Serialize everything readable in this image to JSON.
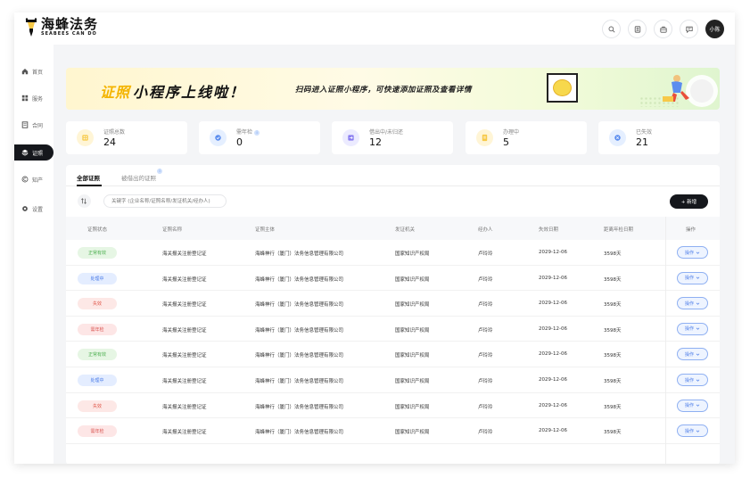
{
  "app": {
    "logo_cn": "海蜂法务",
    "logo_en": "SEABEES CAN DO",
    "avatar": "小陈"
  },
  "sidebar": {
    "items": [
      {
        "label": "首页",
        "icon": "home-icon"
      },
      {
        "label": "服务",
        "icon": "grid-icon"
      },
      {
        "label": "合同",
        "icon": "document-icon"
      },
      {
        "label": "证照",
        "icon": "layers-icon",
        "active": true
      },
      {
        "label": "知产",
        "icon": "copyright-icon"
      },
      {
        "label": "设置",
        "icon": "gear-icon"
      }
    ]
  },
  "banner": {
    "title_highlight": "证照",
    "title_rest": "小程序上线啦！",
    "subtitle": "扫码进入证照小程序，可快速添加证照及查看详情"
  },
  "cards": [
    {
      "label": "证照总数",
      "value": "24",
      "info": false,
      "color": "#f7c948",
      "bg": "#fff5d6"
    },
    {
      "label": "需年检",
      "value": "0",
      "info": true,
      "color": "#5b8def",
      "bg": "#e5efff"
    },
    {
      "label": "借出中/未归还",
      "value": "12",
      "info": false,
      "color": "#8a7df0",
      "bg": "#ecebff"
    },
    {
      "label": "办理中",
      "value": "5",
      "info": false,
      "color": "#f7c948",
      "bg": "#fff5d6"
    },
    {
      "label": "已失效",
      "value": "21",
      "info": false,
      "color": "#5b8def",
      "bg": "#e5efff"
    }
  ],
  "tabs": {
    "all": "全部证照",
    "lent": "被借出的证照",
    "badge": "i"
  },
  "search": {
    "placeholder": "关键字 (企业名称/证照名称/发证机关/经办人)"
  },
  "add_button": "+ 新增",
  "table": {
    "headers": [
      "证照状态",
      "证照名称",
      "证照主体",
      "发证机关",
      "经办人",
      "失效日期",
      "距离年检日期",
      "操作"
    ],
    "rows": [
      {
        "status": "正常有效",
        "status_type": "ok",
        "name": "海关报关注册登记证",
        "subject": "海蜂神行（厦门）法务信息管理有限公司",
        "authority": "国家知识产权局",
        "handler": "卢玲玲",
        "expiry": "2029-12-06",
        "days": "3598天",
        "action": "操作"
      },
      {
        "status": "处理中",
        "status_type": "processing",
        "name": "海关报关注册登记证",
        "subject": "海蜂神行（厦门）法务信息管理有限公司",
        "authority": "国家知识产权局",
        "handler": "卢玲玲",
        "expiry": "2029-12-06",
        "days": "3598天",
        "action": "操作"
      },
      {
        "status": "失效",
        "status_type": "invalid",
        "name": "海关报关注册登记证",
        "subject": "海蜂神行（厦门）法务信息管理有限公司",
        "authority": "国家知识产权局",
        "handler": "卢玲玲",
        "expiry": "2029-12-06",
        "days": "3598天",
        "action": "操作"
      },
      {
        "status": "需年检",
        "status_type": "inspect",
        "name": "海关报关注册登记证",
        "subject": "海蜂神行（厦门）法务信息管理有限公司",
        "authority": "国家知识产权局",
        "handler": "卢玲玲",
        "expiry": "2029-12-06",
        "days": "3598天",
        "action": "操作"
      },
      {
        "status": "正常有效",
        "status_type": "ok",
        "name": "海关报关注册登记证",
        "subject": "海蜂神行（厦门）法务信息管理有限公司",
        "authority": "国家知识产权局",
        "handler": "卢玲玲",
        "expiry": "2029-12-06",
        "days": "3598天",
        "action": "操作"
      },
      {
        "status": "处理中",
        "status_type": "processing",
        "name": "海关报关注册登记证",
        "subject": "海蜂神行（厦门）法务信息管理有限公司",
        "authority": "国家知识产权局",
        "handler": "卢玲玲",
        "expiry": "2029-12-06",
        "days": "3598天",
        "action": "操作"
      },
      {
        "status": "失效",
        "status_type": "invalid",
        "name": "海关报关注册登记证",
        "subject": "海蜂神行（厦门）法务信息管理有限公司",
        "authority": "国家知识产权局",
        "handler": "卢玲玲",
        "expiry": "2029-12-06",
        "days": "3598天",
        "action": "操作"
      },
      {
        "status": "需年检",
        "status_type": "inspect",
        "name": "海关报关注册登记证",
        "subject": "海蜂神行（厦门）法务信息管理有限公司",
        "authority": "国家知识产权局",
        "handler": "卢玲玲",
        "expiry": "2029-12-06",
        "days": "3598天",
        "action": "操作"
      }
    ]
  },
  "status_colors": {
    "ok": {
      "bg": "#e6f6e4",
      "fg": "#4caf50"
    },
    "processing": {
      "bg": "#e4edff",
      "fg": "#4a7be8"
    },
    "invalid": {
      "bg": "#fde8e6",
      "fg": "#e0574a"
    },
    "inspect": {
      "bg": "#fde6e6",
      "fg": "#d9534f"
    }
  }
}
